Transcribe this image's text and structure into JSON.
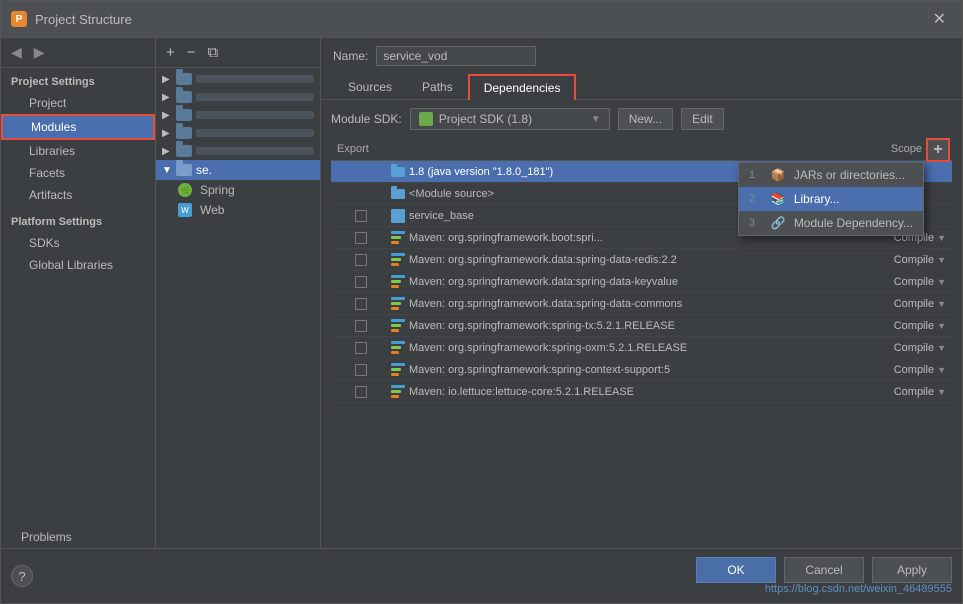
{
  "dialog": {
    "title": "Project Structure",
    "close_label": "✕"
  },
  "left_nav": {
    "project_settings_label": "Project Settings",
    "items": [
      {
        "id": "project",
        "label": "Project"
      },
      {
        "id": "modules",
        "label": "Modules",
        "active": true
      },
      {
        "id": "libraries",
        "label": "Libraries"
      },
      {
        "id": "facets",
        "label": "Facets"
      },
      {
        "id": "artifacts",
        "label": "Artifacts"
      }
    ],
    "platform_settings_label": "Platform Settings",
    "platform_items": [
      {
        "id": "sdks",
        "label": "SDKs"
      },
      {
        "id": "global-libraries",
        "label": "Global Libraries"
      }
    ],
    "problems_label": "Problems"
  },
  "tree": {
    "add_label": "+",
    "remove_label": "−",
    "copy_label": "⧉",
    "items": [
      {
        "label": "se.",
        "selected": true,
        "type": "module-root"
      },
      {
        "label": "Spring",
        "type": "spring",
        "indent": 1
      },
      {
        "label": "Web",
        "type": "web",
        "indent": 1
      }
    ]
  },
  "right": {
    "name_label": "Name:",
    "name_value": "service_vod",
    "tabs": [
      {
        "id": "sources",
        "label": "Sources"
      },
      {
        "id": "paths",
        "label": "Paths"
      },
      {
        "id": "dependencies",
        "label": "Dependencies",
        "active": true
      }
    ],
    "sdk_label": "Module SDK:",
    "sdk_value": "Project SDK (1.8)",
    "new_btn_label": "New...",
    "edit_btn_label": "Edit",
    "table_headers": {
      "export": "Export",
      "name": "",
      "scope": "Scope"
    },
    "add_btn_label": "+",
    "dependencies": [
      {
        "id": "jdk",
        "name": "1.8 (java version \"1.8.0_181\")",
        "scope": "",
        "selected": true,
        "type": "jdk"
      },
      {
        "id": "module-source",
        "name": "<Module source>",
        "scope": "",
        "selected": false,
        "type": "source"
      },
      {
        "id": "service_base",
        "name": "service_base",
        "scope": "",
        "selected": false,
        "type": "module"
      },
      {
        "id": "maven1",
        "name": "Maven: org.springframework.boot:spri...",
        "scope": "Compile",
        "selected": false,
        "type": "maven"
      },
      {
        "id": "maven2",
        "name": "Maven: org.springframework.data:spring-data-redis:2.2",
        "scope": "Compile",
        "selected": false,
        "type": "maven"
      },
      {
        "id": "maven3",
        "name": "Maven: org.springframework.data:spring-data-keyvalue",
        "scope": "Compile",
        "selected": false,
        "type": "maven"
      },
      {
        "id": "maven4",
        "name": "Maven: org.springframework.data:spring-data-commons",
        "scope": "Compile",
        "selected": false,
        "type": "maven"
      },
      {
        "id": "maven5",
        "name": "Maven: org.springframework:spring-tx:5.2.1.RELEASE",
        "scope": "Compile",
        "selected": false,
        "type": "maven"
      },
      {
        "id": "maven6",
        "name": "Maven: org.springframework:spring-oxm:5.2.1.RELEASE",
        "scope": "Compile",
        "selected": false,
        "type": "maven"
      },
      {
        "id": "maven7",
        "name": "Maven: org.springframework:spring-context-support:5",
        "scope": "Compile",
        "selected": false,
        "type": "maven"
      },
      {
        "id": "maven8",
        "name": "Maven: io.lettuce:lettuce-core:5.2.1.RELEASE",
        "scope": "Compile",
        "selected": false,
        "type": "maven"
      }
    ]
  },
  "dropdown": {
    "visible": true,
    "items": [
      {
        "num": "1",
        "label": "JARs or directories..."
      },
      {
        "num": "2",
        "label": "Library...",
        "highlighted": true
      },
      {
        "num": "3",
        "label": "Module Dependency..."
      }
    ]
  },
  "bottom": {
    "help_label": "?",
    "ok_label": "OK",
    "cancel_label": "Cancel",
    "apply_label": "Apply",
    "status_url": "https://blog.csdn.net/weixin_46489555"
  }
}
